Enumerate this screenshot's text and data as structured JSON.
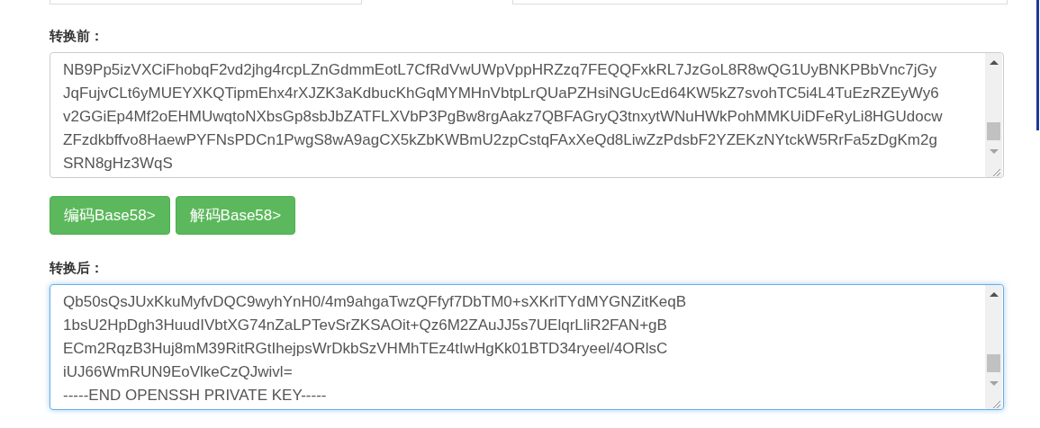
{
  "input_panel": {
    "label": "转换前：",
    "focused": false,
    "lines": [
      "NB9Pp5izVXCiFhobqF2vd2jhg4rcpLZnGdmmEotL7CfRdVwUWpVppHRZzq7FEQQFxkRL7JzGoL8R8wQG1UyBNKPBbVnc7jGy",
      "JqFujvCLt6yMUEYXKQTipmEhx4rXJZK3aKdbucKhGqMYMHnVbtpLrQUaPZHsiNGUcEd64KW5kZ7svohTC5i4L4TuEzRZEyWy6",
      "v2GGiEp4Mf2oEHMUwqtoNXbsGp8sbJbZATFLXVbP3PgBw8rgAakz7QBFAGryQ3tnxytWNuHWkPohMMKUiDFeRyLi8HGUdocw",
      "ZFzdkbffvo8HaewPYFNsPDCn1PwgS8wA9agCX5kZbKWBmU2zpCstqFAxXeQd8LiwZzPdsbF2YZEKzNYtckW5RrFa5zDgKm2g",
      "SRN8gHz3WqS"
    ]
  },
  "buttons": [
    {
      "label": "编码Base58>"
    },
    {
      "label": "解码Base58>"
    }
  ],
  "output_panel": {
    "label": "转换后：",
    "focused": true,
    "lines": [
      "Qb50sQsJUxKkuMyfvDQC9wyhYnH0/4m9ahgaTwzQFfyf7DbTM0+sXKrlTYdMYGNZitKeqB",
      "1bsU2HpDgh3HuudIVbtXG74nZaLPTevSrZKSAOit+Qz6M2ZAuJJ5s7UElqrLliR2FAN+gB",
      "ECm2RqzB3Huj8mM39RitRGtIhejpsWrDkbSzVHMhTEz4tIwHgKk01BTD34ryeel/4ORlsC",
      "iUJ66WmRUN9EoVlkeCzQJwivl=",
      "-----END OPENSSH PRIVATE KEY-----"
    ]
  }
}
